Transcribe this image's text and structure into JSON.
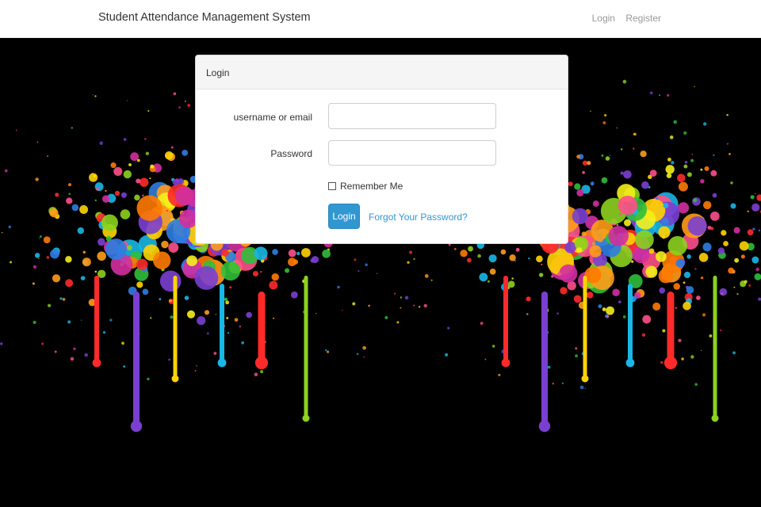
{
  "navbar": {
    "brand": "Student Attendance Management System",
    "links": [
      "Login",
      "Register"
    ]
  },
  "login_card": {
    "header": "Login",
    "username_label": "username or email",
    "username_value": "",
    "password_label": "Password",
    "password_value": "",
    "remember_label": "Remember Me",
    "remember_checked": false,
    "submit_label": "Login",
    "forgot_label": "Forgot Your Password?"
  },
  "colors": {
    "primary": "#3097d1",
    "background": "#000000",
    "navbar_bg": "#ffffff"
  }
}
